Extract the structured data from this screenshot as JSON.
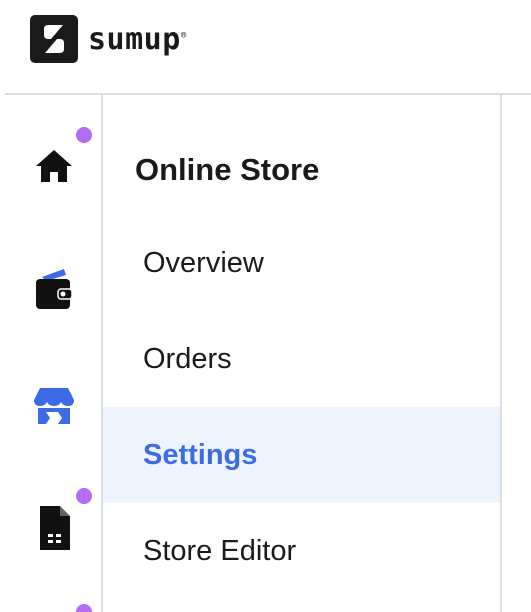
{
  "brand": {
    "name": "sumup",
    "trademark": "®"
  },
  "rail": {
    "items": [
      {
        "icon": "home-icon",
        "badge": true
      },
      {
        "icon": "wallet-icon",
        "badge": false
      },
      {
        "icon": "storefront-icon",
        "badge": false,
        "active": true
      },
      {
        "icon": "invoice-icon",
        "badge": true
      },
      {
        "icon": "more-icon",
        "badge": true
      }
    ]
  },
  "panel": {
    "title": "Online Store",
    "items": [
      {
        "label": "Overview"
      },
      {
        "label": "Orders"
      },
      {
        "label": "Settings",
        "active": true
      },
      {
        "label": "Store Editor"
      }
    ]
  },
  "colors": {
    "accent": "#3b6ce6",
    "activeBg": "#eef4fd",
    "badge": "#b46cf0",
    "text": "#1a1a1a"
  }
}
